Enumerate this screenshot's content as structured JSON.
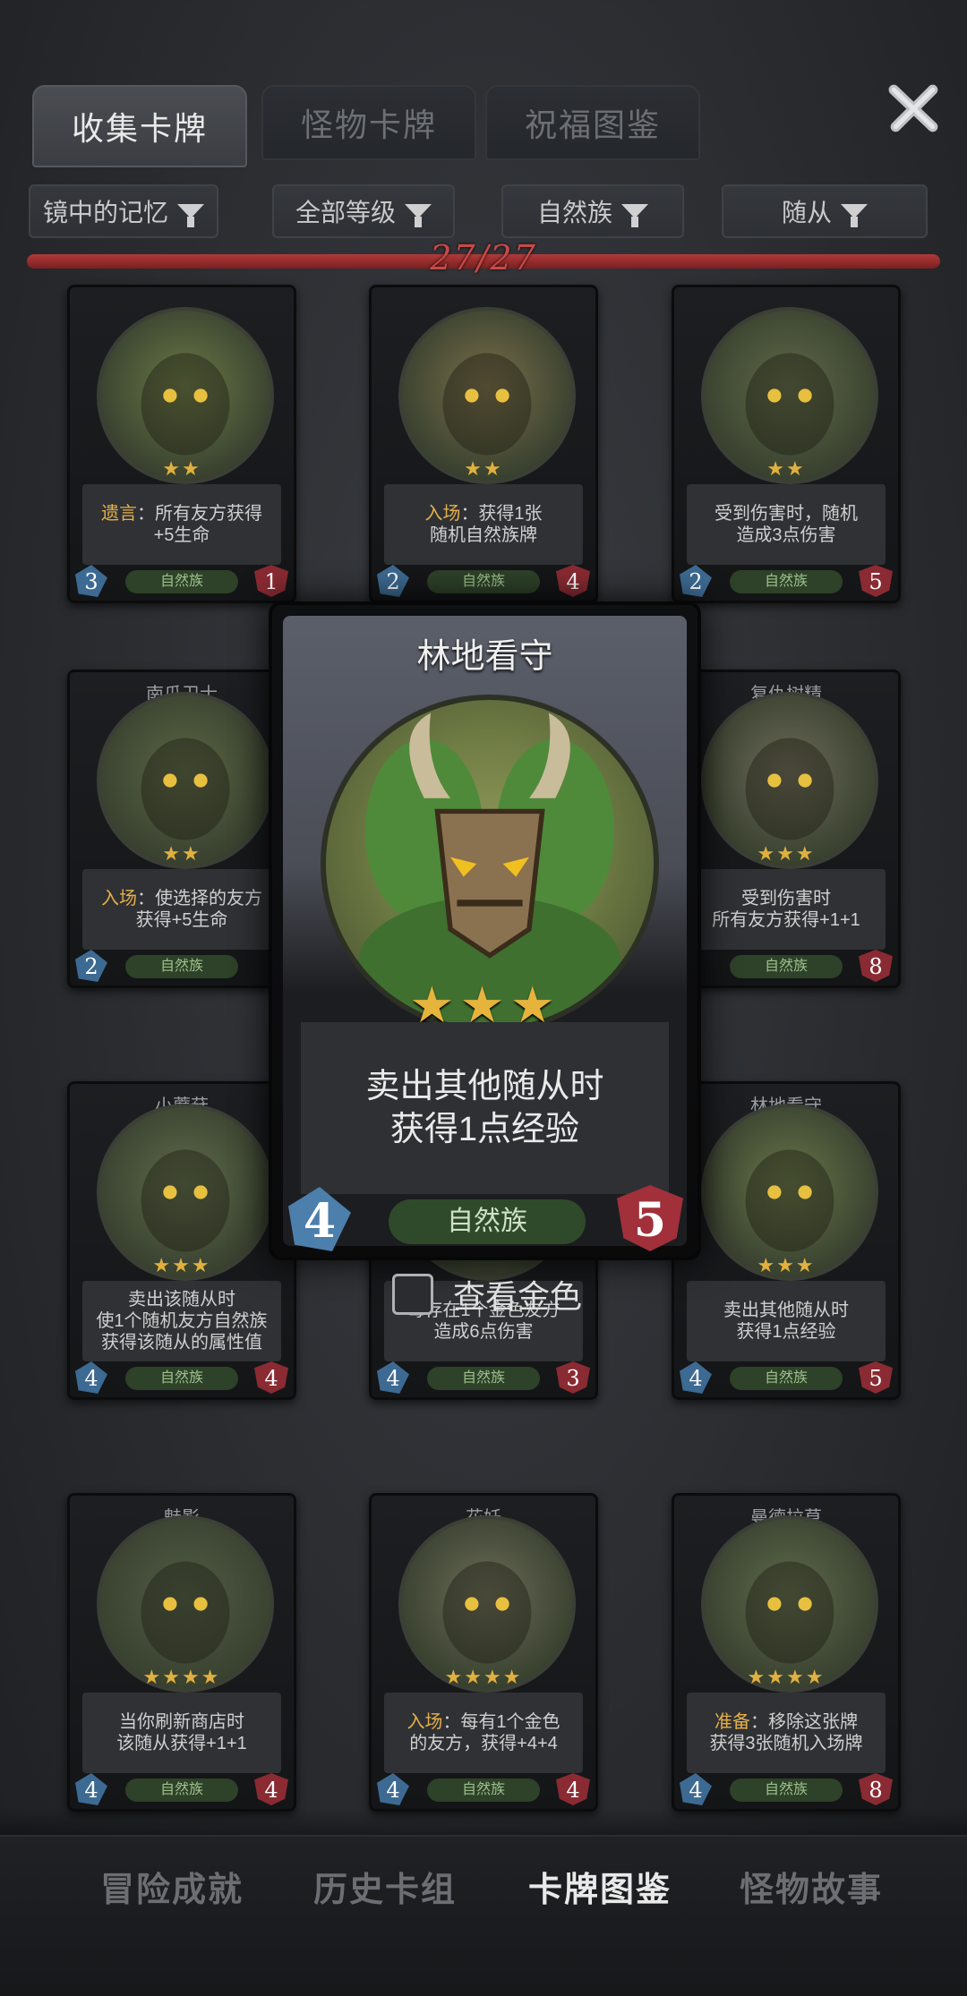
{
  "tabs": [
    {
      "label": "收集卡牌",
      "active": true
    },
    {
      "label": "怪物卡牌",
      "active": false
    },
    {
      "label": "祝福图鉴",
      "active": false
    }
  ],
  "filters": [
    "镜中的记忆",
    "全部等级",
    "自然族",
    "随从"
  ],
  "progress": {
    "text": "27/27",
    "fraction": 1.0
  },
  "cards": [
    {
      "name": "",
      "stars": "★★",
      "desc1_hl": "遗言",
      "desc1": "：所有友方获得",
      "desc2": "+5生命",
      "tribe": "自然族",
      "cost": "3",
      "hp": "1"
    },
    {
      "name": "",
      "stars": "★★",
      "desc1_hl": "入场",
      "desc1": "：获得1张",
      "desc2": "随机自然族牌",
      "tribe": "自然族",
      "cost": "2",
      "hp": "4"
    },
    {
      "name": "",
      "stars": "★★",
      "desc1_hl": "",
      "desc1": "受到伤害时，随机",
      "desc2": "造成3点伤害",
      "tribe": "自然族",
      "cost": "2",
      "hp": "5"
    },
    {
      "name": "南瓜卫士",
      "stars": "★★",
      "desc1_hl": "入场",
      "desc1": "：使选择的友方",
      "desc2": "获得+5生命",
      "tribe": "自然族",
      "cost": "2",
      "hp": ""
    },
    {
      "name": "复仇树精",
      "stars": "★★★",
      "desc1_hl": "",
      "desc1": "受到伤害时",
      "desc2": "所有友方获得+1+1",
      "tribe": "自然族",
      "cost": "",
      "hp": "8"
    },
    {
      "name": "小蘑菇",
      "stars": "★★★",
      "desc1_hl": "",
      "desc1": "卖出该随从时",
      "desc2": "使1个随机友方自然族",
      "desc3": "获得该随从的属性值",
      "tribe": "自然族",
      "cost": "4",
      "hp": "4"
    },
    {
      "name": "",
      "stars": "",
      "desc1_hl": "",
      "desc1": "每存在1个金色友方",
      "desc2": "造成6点伤害",
      "tribe": "自然族",
      "cost": "4",
      "hp": "3"
    },
    {
      "name": "林地看守",
      "stars": "★★★",
      "desc1_hl": "",
      "desc1": "卖出其他随从时",
      "desc2": "获得1点经验",
      "tribe": "自然族",
      "cost": "4",
      "hp": "5"
    },
    {
      "name": "魅影",
      "stars": "★★★★",
      "desc1_hl": "",
      "desc1": "当你刷新商店时",
      "desc2": "该随从获得+1+1",
      "tribe": "自然族",
      "cost": "4",
      "hp": "4"
    },
    {
      "name": "花妖",
      "stars": "★★★★",
      "desc1_hl": "入场",
      "desc1": "：每有1个金色",
      "desc2": "的友方，获得+4+4",
      "tribe": "自然族",
      "cost": "4",
      "hp": "4"
    },
    {
      "name": "曼德拉草",
      "stars": "★★★★",
      "desc1_hl": "准备",
      "desc1": "：移除这张牌",
      "desc2": "获得3张随机入场牌",
      "tribe": "自然族",
      "cost": "4",
      "hp": "8"
    }
  ],
  "popup": {
    "title": "林地看守",
    "stars": "★★★",
    "desc1": "卖出其他随从时",
    "desc2": "获得1点经验",
    "tribe": "自然族",
    "cost": "4",
    "hp": "5"
  },
  "gold_toggle": {
    "label": "查看金色",
    "checked": false
  },
  "bottom_nav": [
    {
      "label": "冒险成就",
      "active": false
    },
    {
      "label": "历史卡组",
      "active": false
    },
    {
      "label": "卡牌图鉴",
      "active": true
    },
    {
      "label": "怪物故事",
      "active": false
    }
  ],
  "colors": {
    "accent_red": "#c94848",
    "highlight": "#e6b04a",
    "tribe_green": "#2e4129"
  }
}
